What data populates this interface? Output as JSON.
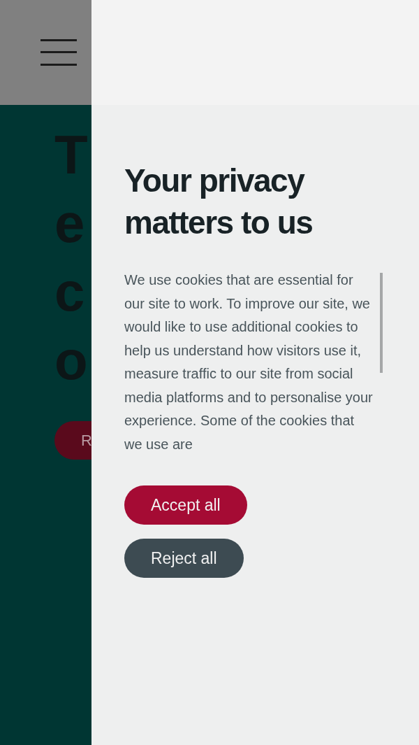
{
  "background_page": {
    "hero_heading_lines": [
      "T",
      "e",
      "c",
      "o"
    ],
    "hero_button": "R"
  },
  "cookie_dialog": {
    "title": "Your privacy matters to us",
    "body": "We use cookies that are essential for our site to work. To improve our site, we would like to use additional cookies to help us understand how visitors use it, measure traffic to our site from social media platforms and to personalise your experience. Some of the cookies that we use are",
    "buttons": [
      {
        "label": "Accept all",
        "kind": "primary"
      },
      {
        "label": "Reject all",
        "kind": "secondary"
      }
    ]
  }
}
